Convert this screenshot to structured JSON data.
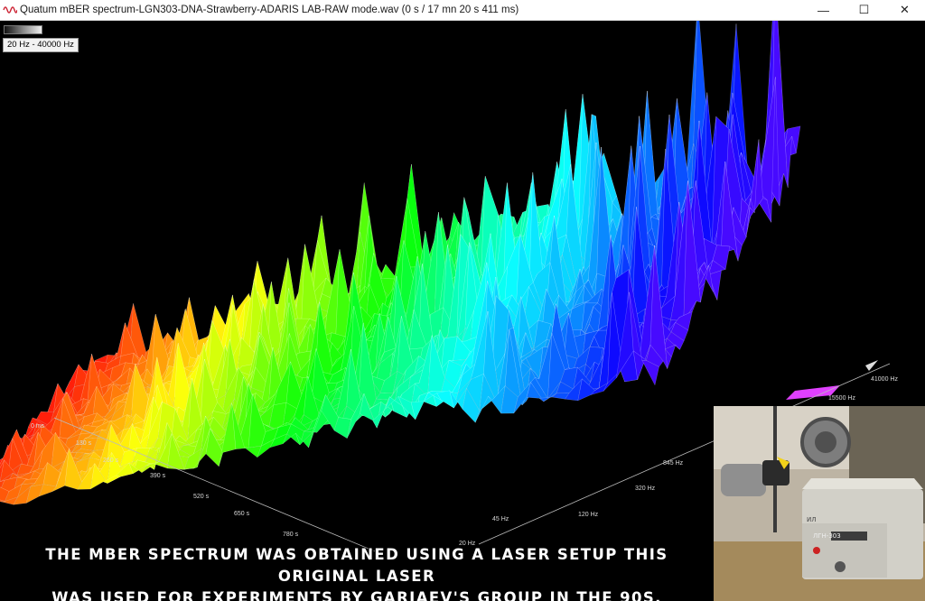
{
  "window": {
    "title": "Quatum mBER spectrum-LGN303-DNA-Strawberry-ADARIS LAB-RAW mode.wav (0 s / 17 mn 20 s 411 ms)",
    "minimize_glyph": "—",
    "maximize_glyph": "☐",
    "close_glyph": "✕",
    "icon": "waveform-icon"
  },
  "toolbar": {
    "frequency_range": "20 Hz - 40000 Hz"
  },
  "plot": {
    "time_axis_ticks": [
      "0 ms",
      "130 s",
      "260 s",
      "390 s",
      "520 s",
      "650 s",
      "780 s"
    ],
    "frequency_axis_ticks": [
      "45 Hz",
      "120 Hz",
      "320 Hz",
      "845 Hz",
      "15500 Hz",
      "41000 Hz"
    ],
    "partial_tick": "20 Hz"
  },
  "caption": {
    "line1": "The mBER spectrum was obtained using a laser setup this original laser",
    "line2": "was used for experiments by Gariaev's group in the 90s."
  },
  "photo": {
    "panel_brand": "ЛГН-303",
    "panel_mark": "ИЛ"
  },
  "colors": {
    "background": "#000000",
    "titlebar": "#ffffff",
    "spectrum_low_freq": "#ff2200",
    "spectrum_high_freq": "#5a1dff"
  }
}
